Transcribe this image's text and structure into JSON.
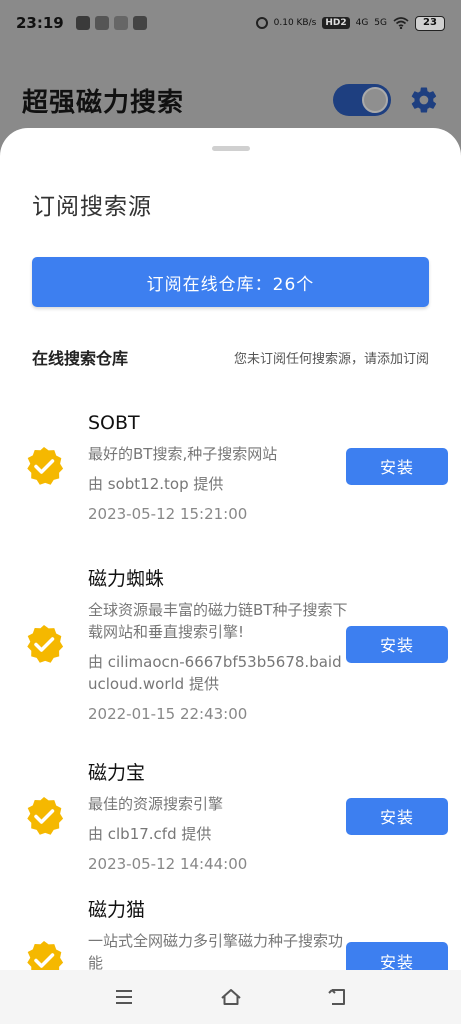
{
  "status_bar": {
    "time": "23:19",
    "net_speed": "0.10 KB/s",
    "hd": "HD2",
    "signal1": "4G",
    "signal2": "5G",
    "battery": "23"
  },
  "app": {
    "title": "超强磁力搜索",
    "toggle_on": true
  },
  "sheet": {
    "title": "订阅搜索源",
    "subscribe_button": "订阅在线仓库：26个",
    "repo_label": "在线搜索仓库",
    "repo_hint": "您未订阅任何搜索源，请添加订阅"
  },
  "sources": [
    {
      "name": "SOBT",
      "desc": "最好的BT搜索,种子搜索网站",
      "provider": "由 sobt12.top 提供",
      "time": "2023-05-12 15:21:00",
      "action": "安装"
    },
    {
      "name": "磁力蜘蛛",
      "desc": "全球资源最丰富的磁力链BT种子搜索下载网站和垂直搜索引擎!",
      "provider": "由 cilimaocn-6667bf53b5678.baiducloud.world 提供",
      "time": "2022-01-15 22:43:00",
      "action": "安装"
    },
    {
      "name": "磁力宝",
      "desc": "最佳的资源搜索引擎",
      "provider": "由 clb17.cfd 提供",
      "time": "2023-05-12 14:44:00",
      "action": "安装"
    },
    {
      "name": "磁力猫",
      "desc": "一站式全网磁力多引擎磁力种子搜索功能",
      "action": "安装"
    }
  ],
  "colors": {
    "primary": "#3d7ff0",
    "badge": "#f5b800",
    "toggle": "#1e3f80"
  },
  "icons": {
    "settings": "gear-icon",
    "badge": "verified-badge-icon",
    "nav_menu": "menu-icon",
    "nav_home": "home-icon",
    "nav_back": "back-icon"
  }
}
